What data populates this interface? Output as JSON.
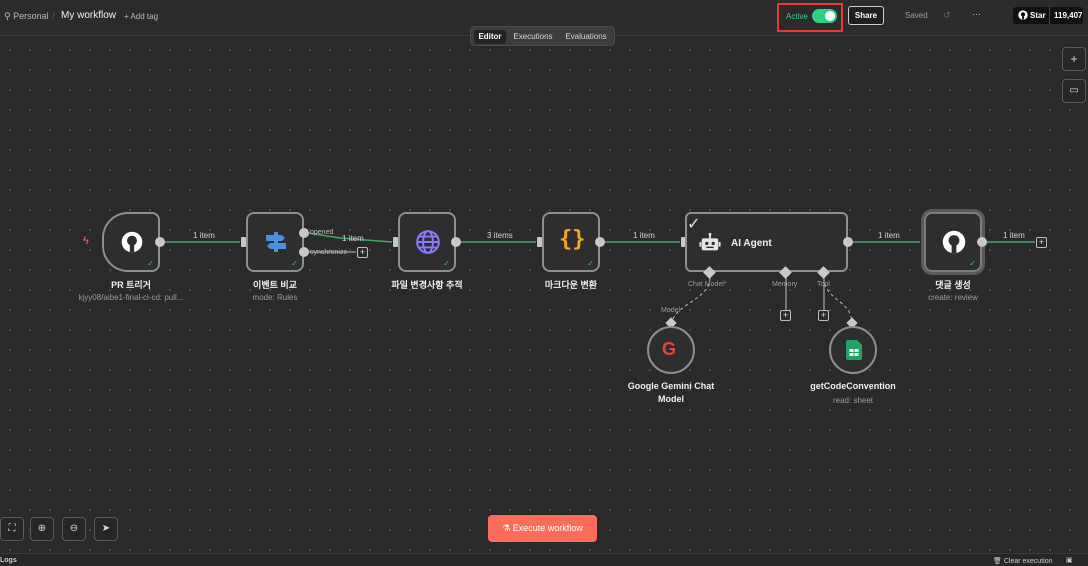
{
  "header": {
    "breadcrumb_personal": "Personal",
    "workflow_title": "My workflow",
    "add_tag": "+ Add tag",
    "active_label": "Active",
    "share_label": "Share",
    "saved_label": "Saved",
    "more_label": "···",
    "star_label": "Star",
    "star_count": "119,407"
  },
  "tabs": [
    "Editor",
    "Executions",
    "Evaluations"
  ],
  "nodes": {
    "pr_trigger": {
      "label": "PR 트리거",
      "sub": "kjyy08/aibe1-final-ci-cd: pull..."
    },
    "event_compare": {
      "label": "이벤트 비교",
      "sub": "mode: Rules"
    },
    "file_changes": {
      "label": "파일 변경사항 추적"
    },
    "markdown": {
      "label": "마크다운 변환"
    },
    "ai_agent": {
      "label": "AI Agent",
      "port_chat": "Chat Model",
      "port_memory": "Memory",
      "port_tool": "Tool"
    },
    "comment": {
      "label": "댓글 생성",
      "sub": "create: review"
    },
    "gemini": {
      "label_line1": "Google Gemini Chat",
      "label_line2": "Model",
      "port_label": "Model"
    },
    "get_convention": {
      "label": "getCodeConvention",
      "sub": "read: sheet"
    }
  },
  "edges": {
    "e1": "1 item",
    "opened": "opened",
    "e2": "1 item",
    "synchronize": "synchronize",
    "e3": "3 items",
    "e4": "1 item",
    "e5": "1 item",
    "e6": "1 item"
  },
  "footer": {
    "execute_label": "Execute workflow",
    "logs_label": "Logs",
    "clear_label": "Clear execution"
  },
  "colors": {
    "accent": "#ff6d5a",
    "active_green": "#2fcf83",
    "edge_green": "#3fa86b"
  },
  "icons": [
    "github-icon",
    "switch-icon",
    "globe-icon",
    "braces-icon",
    "robot-icon",
    "google-icon",
    "sheet-icon",
    "bolt-icon"
  ]
}
